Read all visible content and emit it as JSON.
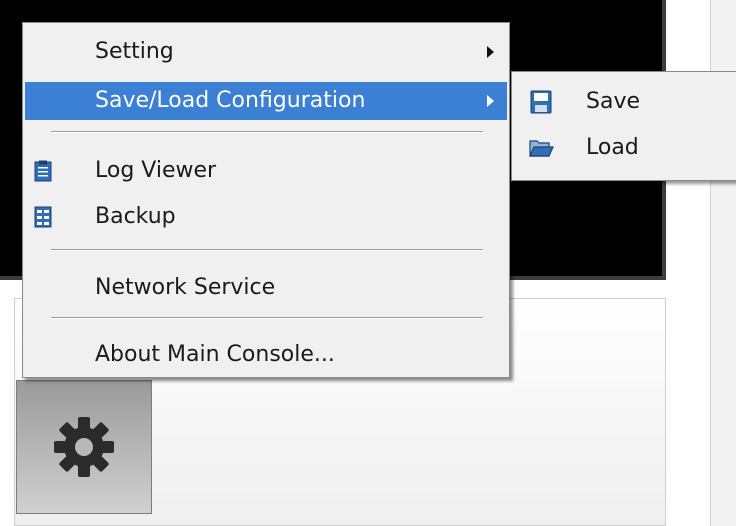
{
  "menu": {
    "items": [
      {
        "label": "Setting",
        "has_submenu": true,
        "highlighted": false
      },
      {
        "label": "Save/Load Configuration",
        "has_submenu": true,
        "highlighted": true
      },
      {
        "label": "Log Viewer",
        "icon": "clipboard-icon"
      },
      {
        "label": "Backup",
        "icon": "backup-icon"
      },
      {
        "label": "Network Service"
      },
      {
        "label": "About Main Console..."
      }
    ]
  },
  "submenu": {
    "items": [
      {
        "label": "Save",
        "icon": "floppy-disk-icon"
      },
      {
        "label": "Load",
        "icon": "folder-open-icon"
      }
    ]
  },
  "colors": {
    "highlight": "#3c80d6",
    "menu_bg": "#f0f0f0",
    "icon_blue": "#2f6fb6"
  }
}
